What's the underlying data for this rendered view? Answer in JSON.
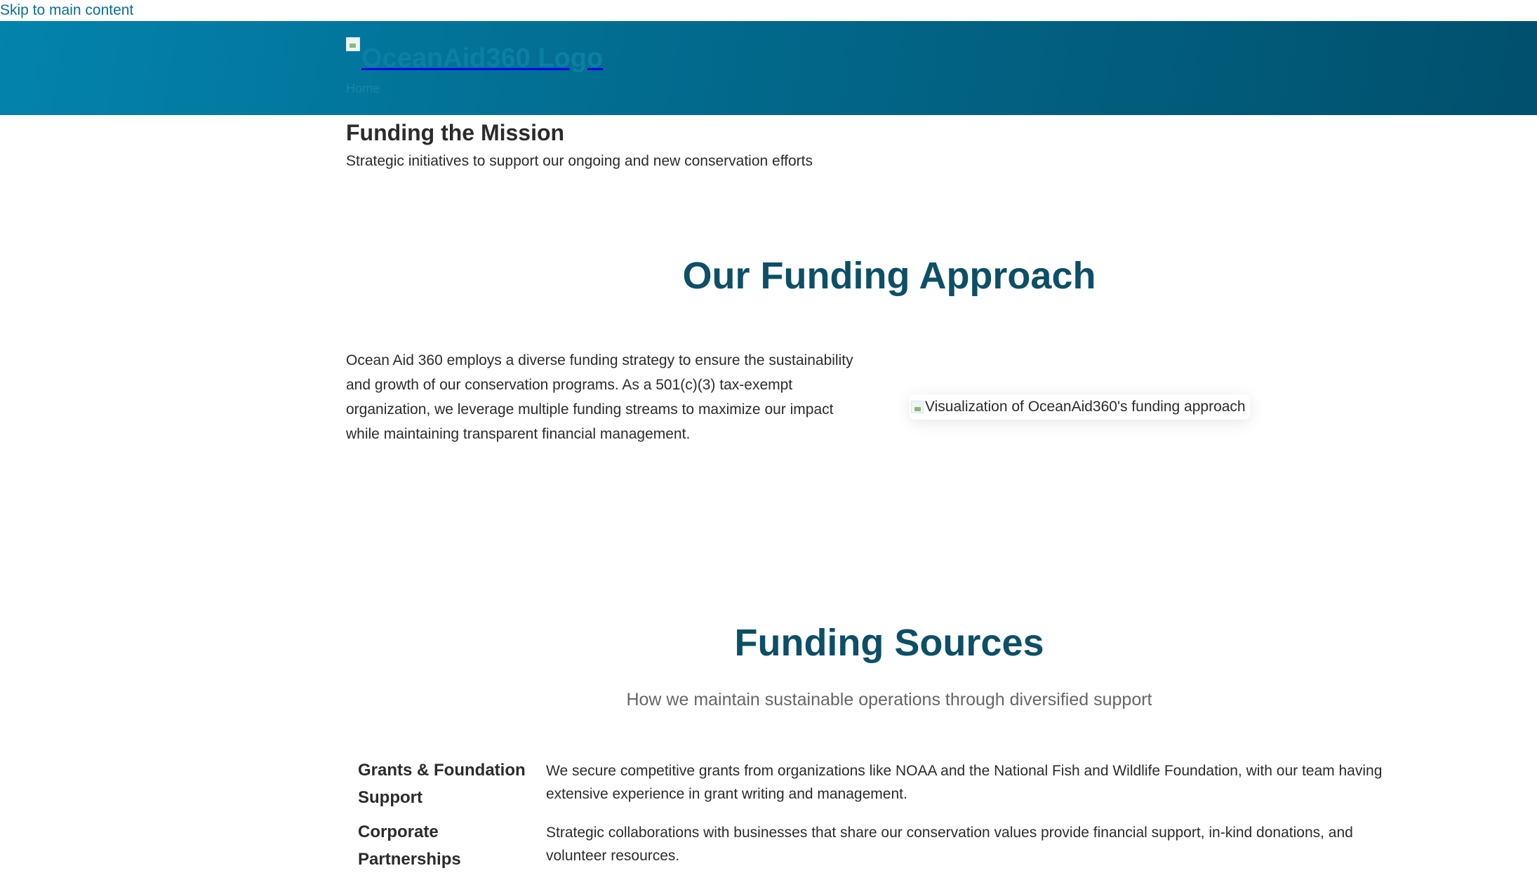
{
  "skip_link": "Skip to main content",
  "header": {
    "logo_alt": "OceanAid360 Logo",
    "nav_home": "Home"
  },
  "hero": {
    "title": "Funding the Mission",
    "subtitle": "Strategic initiatives to support our ongoing and new conservation efforts"
  },
  "approach": {
    "title": "Our Funding Approach",
    "text": "Ocean Aid 360 employs a diverse funding strategy to ensure the sustainability and growth of our conservation programs. As a 501(c)(3) tax-exempt organization, we leverage multiple funding streams to maximize our impact while maintaining transparent financial management.",
    "image_alt": "Visualization of OceanAid360's funding approach"
  },
  "sources": {
    "title": "Funding Sources",
    "subtitle": "How we maintain sustainable operations through diversified support",
    "items": [
      {
        "name": "Grants & Foundation Support",
        "desc": "We secure competitive grants from organizations like NOAA and the National Fish and Wildlife Foundation, with our team having extensive experience in grant writing and management."
      },
      {
        "name": "Corporate Partnerships",
        "desc": "Strategic collaborations with businesses that share our conservation values provide financial support, in-kind donations, and volunteer resources."
      }
    ]
  },
  "colors": {
    "header_gradient_start": "#0383ad",
    "header_gradient_end": "#01506d",
    "heading_teal": "#0c4f66",
    "link": "#0a6e8f"
  }
}
